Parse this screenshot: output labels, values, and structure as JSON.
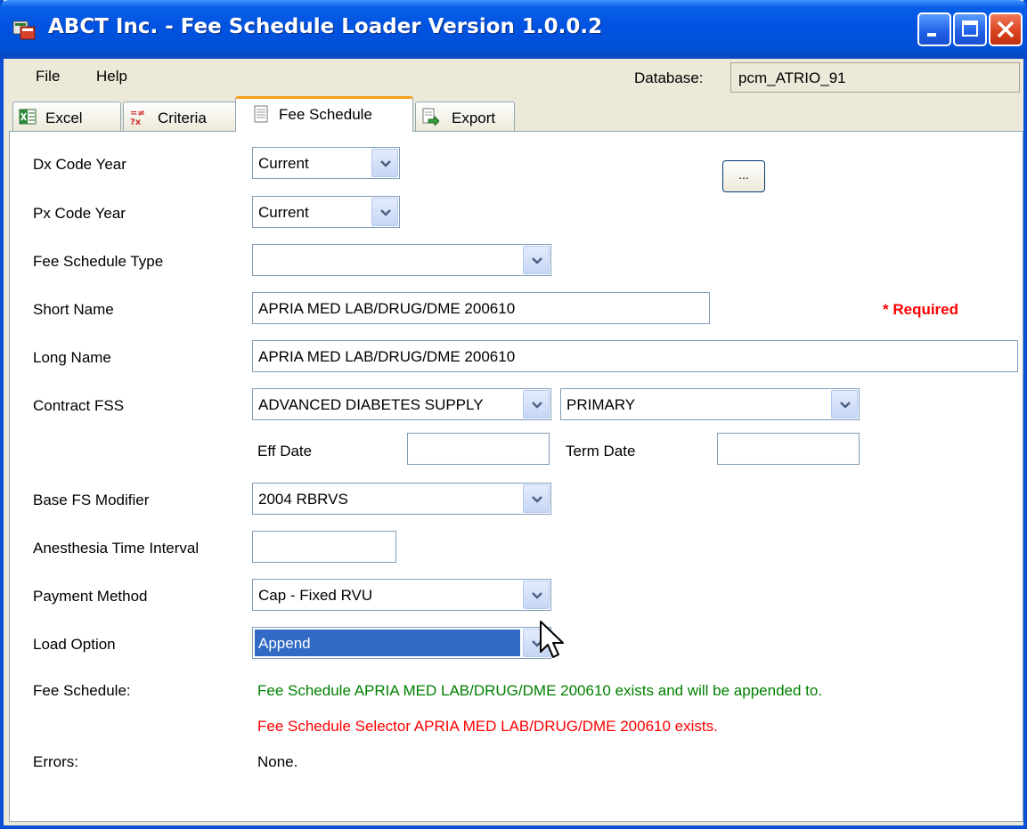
{
  "window": {
    "title": "ABCT Inc. - Fee Schedule Loader Version 1.0.0.2"
  },
  "menu": {
    "file": "File",
    "help": "Help"
  },
  "database": {
    "label": "Database:",
    "value": "pcm_ATRIO_91"
  },
  "tabs": [
    {
      "label": "Excel"
    },
    {
      "label": "Criteria"
    },
    {
      "label": "Fee Schedule"
    },
    {
      "label": "Export"
    }
  ],
  "form": {
    "dx_code_year": {
      "label": "Dx Code Year",
      "value": "Current"
    },
    "px_code_year": {
      "label": "Px Code Year",
      "value": "Current"
    },
    "fee_schedule_type": {
      "label": "Fee Schedule Type",
      "value": ""
    },
    "short_name": {
      "label": "Short Name",
      "value": "APRIA MED LAB/DRUG/DME 200610",
      "browse": "...",
      "required": "* Required"
    },
    "long_name": {
      "label": "Long Name",
      "value": "APRIA MED LAB/DRUG/DME 200610"
    },
    "contract_fss": {
      "label": "Contract FSS",
      "value": "ADVANCED DIABETES SUPPLY",
      "type_value": "PRIMARY"
    },
    "eff_date": {
      "label": "Eff Date",
      "value": ""
    },
    "term_date": {
      "label": "Term Date",
      "value": ""
    },
    "base_fs_modifier": {
      "label": "Base FS Modifier",
      "value": "2004 RBRVS"
    },
    "anesthesia_time_interval": {
      "label": "Anesthesia Time Interval",
      "value": ""
    },
    "payment_method": {
      "label": "Payment Method",
      "value": "Cap - Fixed RVU"
    },
    "load_option": {
      "label": "Load Option",
      "value": "Append"
    }
  },
  "status": {
    "fee_schedule_label": "Fee Schedule:",
    "fee_schedule_msg": "Fee Schedule APRIA MED LAB/DRUG/DME 200610 exists and will be appended to.",
    "selector_msg": "Fee Schedule Selector APRIA MED LAB/DRUG/DME 200610 exists.",
    "errors_label": "Errors:",
    "errors_value": "None."
  },
  "colors": {
    "title_bar": "#0053e1",
    "success_text": "#008000",
    "error_text": "#ff0000",
    "selection": "#316ac5",
    "active_tab_highlight": "#f9a01c"
  }
}
